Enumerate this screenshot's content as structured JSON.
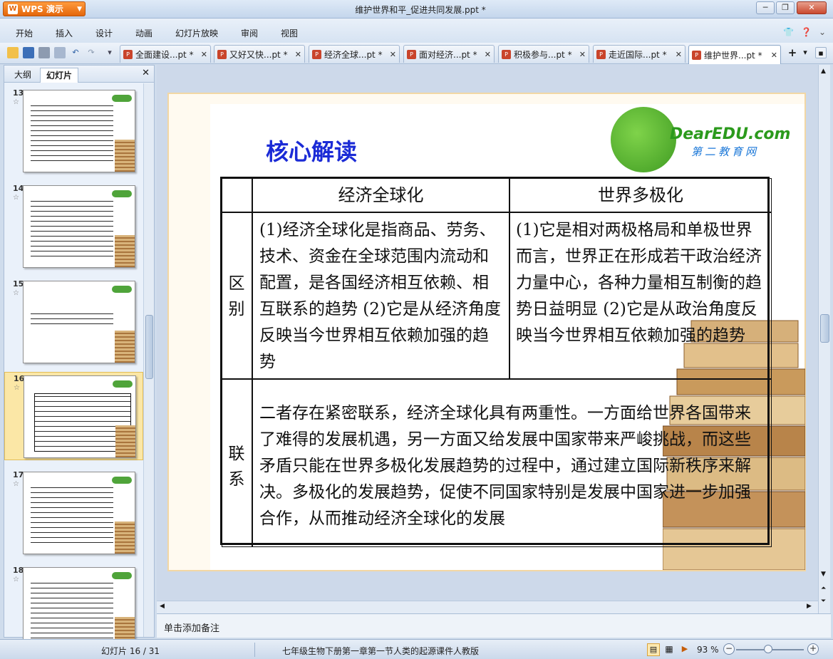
{
  "app": {
    "name": "WPS 演示",
    "title": "维护世界和平_促进共同发展.ppt *"
  },
  "menu": [
    "开始",
    "插入",
    "设计",
    "动画",
    "幻灯片放映",
    "审阅",
    "视图"
  ],
  "doc_tabs": [
    {
      "label": "全面建设...pt *"
    },
    {
      "label": "又好又快...pt *"
    },
    {
      "label": "经济全球...pt *"
    },
    {
      "label": "面对经济...pt *"
    },
    {
      "label": "积极参与...pt *"
    },
    {
      "label": "走近国际...pt *"
    },
    {
      "label": "维护世界...pt *"
    }
  ],
  "side_tabs": {
    "outline": "大纲",
    "slides": "幻灯片"
  },
  "thumbnails": [
    {
      "num": "13"
    },
    {
      "num": "14"
    },
    {
      "num": "15"
    },
    {
      "num": "16"
    },
    {
      "num": "17"
    },
    {
      "num": "18"
    }
  ],
  "slide": {
    "title": "核心解读",
    "logo_brand": "DearEDU.com",
    "logo_sub": "第二教育网",
    "table": {
      "col1": "经济全球化",
      "col2": "世界多极化",
      "row1_head": "区别",
      "row1_c1": "(1)经济全球化是指商品、劳务、技术、资金在全球范围内流动和配置，是各国经济相互依赖、相互联系的趋势 (2)它是从经济角度反映当今世界相互依赖加强的趋势",
      "row1_c2": "(1)它是相对两极格局和单极世界而言，世界正在形成若干政治经济力量中心，各种力量相互制衡的趋势日益明显 (2)它是从政治角度反映当今世界相互依赖加强的趋势",
      "row2_head": "联系",
      "row2_text": "二者存在紧密联系，经济全球化具有两重性。一方面给世界各国带来了难得的发展机遇，另一方面又给发展中国家带来严峻挑战，而这些矛盾只能在世界多极化发展趋势的过程中，通过建立国际新秩序来解决。多极化的发展趋势，促使不同国家特别是发展中国家进一步加强合作，从而推动经济全球化的发展"
    }
  },
  "notes_placeholder": "单击添加备注",
  "status": {
    "slide_counter": "幻灯片 16 / 31",
    "template": "七年级生物下册第一章第一节人类的起源课件人教版",
    "zoom": "93 %"
  }
}
